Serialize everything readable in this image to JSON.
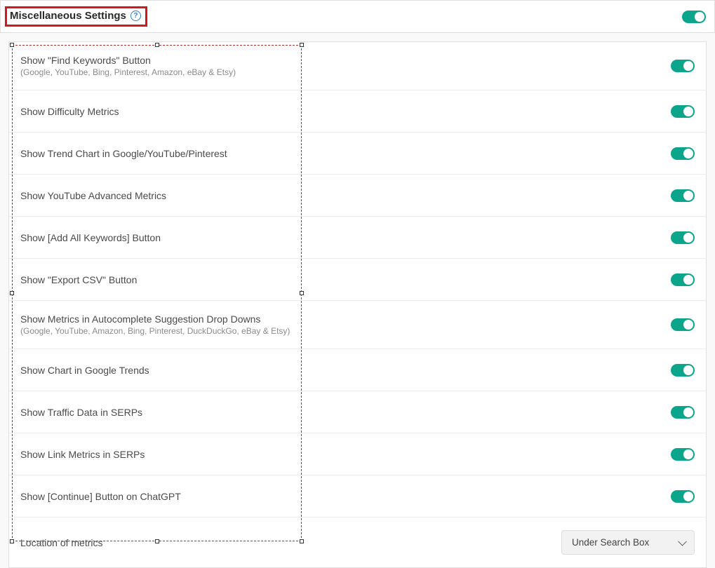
{
  "header": {
    "title": "Miscellaneous Settings",
    "help_symbol": "?",
    "toggle_on": true
  },
  "settings": [
    {
      "title": "Show \"Find Keywords\" Button",
      "subtitle": "(Google, YouTube, Bing, Pinterest, Amazon, eBay & Etsy)",
      "type": "toggle",
      "on": true
    },
    {
      "title": "Show Difficulty Metrics",
      "subtitle": "",
      "type": "toggle",
      "on": true
    },
    {
      "title": "Show Trend Chart in Google/YouTube/Pinterest",
      "subtitle": "",
      "type": "toggle",
      "on": true
    },
    {
      "title": "Show YouTube Advanced Metrics",
      "subtitle": "",
      "type": "toggle",
      "on": true
    },
    {
      "title": "Show [Add All Keywords] Button",
      "subtitle": "",
      "type": "toggle",
      "on": true
    },
    {
      "title": "Show \"Export CSV\" Button",
      "subtitle": "",
      "type": "toggle",
      "on": true
    },
    {
      "title": "Show Metrics in Autocomplete Suggestion Drop Downs",
      "subtitle": "(Google, YouTube, Amazon, Bing, Pinterest, DuckDuckGo, eBay & Etsy)",
      "type": "toggle",
      "on": true
    },
    {
      "title": "Show Chart in Google Trends",
      "subtitle": "",
      "type": "toggle",
      "on": true
    },
    {
      "title": "Show Traffic Data in SERPs",
      "subtitle": "",
      "type": "toggle",
      "on": true
    },
    {
      "title": "Show Link Metrics in SERPs",
      "subtitle": "",
      "type": "toggle",
      "on": true
    },
    {
      "title": "Show [Continue] Button on ChatGPT",
      "subtitle": "",
      "type": "toggle",
      "on": true
    },
    {
      "title": "Location of metrics",
      "subtitle": "",
      "type": "dropdown",
      "value": "Under Search Box"
    }
  ]
}
